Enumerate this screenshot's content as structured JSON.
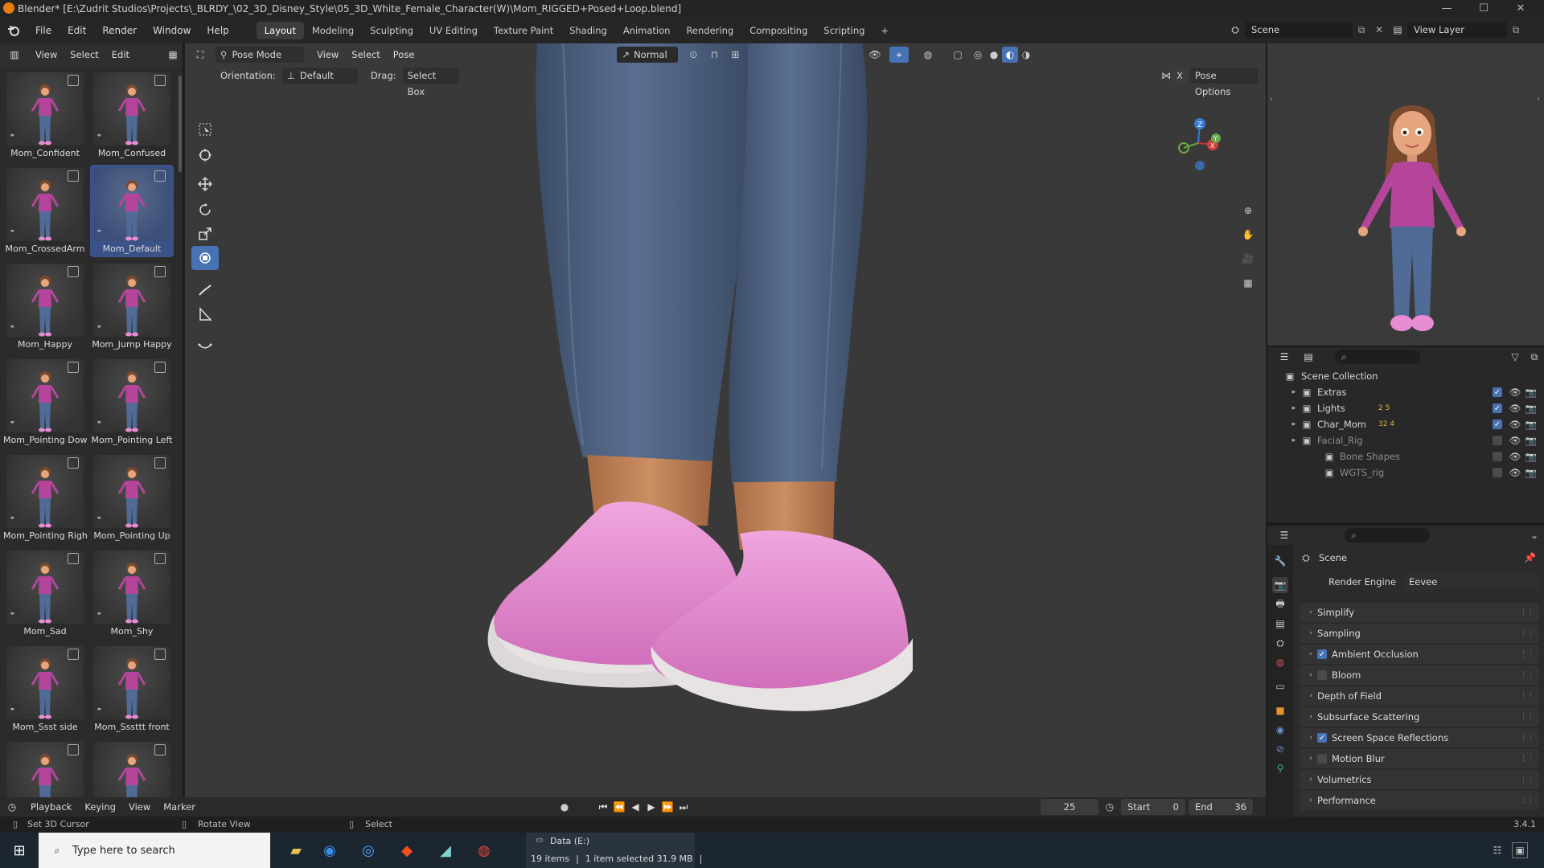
{
  "window": {
    "title": "Blender* [E:\\Zudrit Studios\\Projects\\_BLRDY_\\02_3D_Disney_Style\\05_3D_White_Female_Character(W)\\Mom_RIGGED+Posed+Loop.blend]",
    "minimize": "—",
    "maximize": "☐",
    "close": "✕"
  },
  "menu": [
    "File",
    "Edit",
    "Render",
    "Window",
    "Help"
  ],
  "workspaces": [
    "Layout",
    "Modeling",
    "Sculpting",
    "UV Editing",
    "Texture Paint",
    "Shading",
    "Animation",
    "Rendering",
    "Compositing",
    "Scripting"
  ],
  "workspace_add": "+",
  "scene_field": "Scene",
  "view_layer_field": "View Layer",
  "asset_browser": {
    "header": [
      "View",
      "Select",
      "Edit"
    ],
    "items": [
      {
        "label": "Mom_Confident",
        "selected": false
      },
      {
        "label": "Mom_Confused",
        "selected": false
      },
      {
        "label": "Mom_CrossedArm",
        "selected": false
      },
      {
        "label": "Mom_Default",
        "selected": true
      },
      {
        "label": "Mom_Happy",
        "selected": false
      },
      {
        "label": "Mom_Jump Happy",
        "selected": false
      },
      {
        "label": "Mom_Pointing Down",
        "selected": false
      },
      {
        "label": "Mom_Pointing Left",
        "selected": false
      },
      {
        "label": "Mom_Pointing Right",
        "selected": false
      },
      {
        "label": "Mom_Pointing Up",
        "selected": false
      },
      {
        "label": "Mom_Sad",
        "selected": false
      },
      {
        "label": "Mom_Shy",
        "selected": false
      },
      {
        "label": "Mom_Ssst side",
        "selected": false
      },
      {
        "label": "Mom_Sssttt front",
        "selected": false
      },
      {
        "label": "",
        "selected": false
      },
      {
        "label": "",
        "selected": false
      }
    ]
  },
  "viewport": {
    "mode": "Pose Mode",
    "menus": [
      "View",
      "Select",
      "Pose"
    ],
    "transform_orientation": "Normal",
    "orientation_label": "Orientation:",
    "orientation_value": "Default",
    "drag_label": "Drag:",
    "drag_value": "Select Box",
    "pose_options": "Pose Options",
    "x_mirror": "X",
    "gizmo_axes": [
      "Z",
      "Y",
      "X"
    ]
  },
  "timeline": {
    "menus": [
      "Playback",
      "Keying",
      "View",
      "Marker"
    ],
    "current_frame": "25",
    "start_label": "Start",
    "start_value": "0",
    "end_label": "End",
    "end_value": "36"
  },
  "statusbar": {
    "left_hint": "Set 3D Cursor",
    "mid_hint": "Rotate View",
    "right_hint": "Select",
    "version": "3.4.1"
  },
  "outliner": {
    "root": "Scene Collection",
    "rows": [
      {
        "label": "Extras",
        "badge": "",
        "dim": false,
        "indent": 0
      },
      {
        "label": "Lights",
        "badge": "2 5",
        "dim": false,
        "indent": 0
      },
      {
        "label": "Char_Mom",
        "badge": "32 4",
        "dim": false,
        "indent": 0
      },
      {
        "label": "Facial_Rig",
        "badge": "",
        "dim": true,
        "indent": 0
      },
      {
        "label": "Bone Shapes",
        "badge": "",
        "dim": true,
        "indent": 1
      },
      {
        "label": "WGTS_rig",
        "badge": "",
        "dim": true,
        "indent": 1
      }
    ]
  },
  "properties": {
    "context": "Scene",
    "render_engine_label": "Render Engine",
    "render_engine_value": "Eevee",
    "sections": [
      {
        "label": "Simplify",
        "checkbox": false,
        "checked": false
      },
      {
        "label": "Sampling",
        "checkbox": false,
        "checked": false
      },
      {
        "label": "Ambient Occlusion",
        "checkbox": true,
        "checked": true
      },
      {
        "label": "Bloom",
        "checkbox": true,
        "checked": false
      },
      {
        "label": "Depth of Field",
        "checkbox": false,
        "checked": false
      },
      {
        "label": "Subsurface Scattering",
        "checkbox": false,
        "checked": false
      },
      {
        "label": "Screen Space Reflections",
        "checkbox": true,
        "checked": true
      },
      {
        "label": "Motion Blur",
        "checkbox": true,
        "checked": false
      },
      {
        "label": "Volumetrics",
        "checkbox": false,
        "checked": false
      },
      {
        "label": "Performance",
        "checkbox": false,
        "checked": false
      }
    ]
  },
  "taskbar": {
    "search_placeholder": "Type here to search",
    "drive_tooltip": "Data (E:)",
    "items_count": "19 items",
    "selection_info": "1 item selected  31.9 MB"
  },
  "colors": {
    "accent": "#4772b3",
    "jeans": "#4d6180",
    "shoe": "#e48bd0",
    "sole": "#e9e6e6",
    "skin": "#c88a5e"
  }
}
